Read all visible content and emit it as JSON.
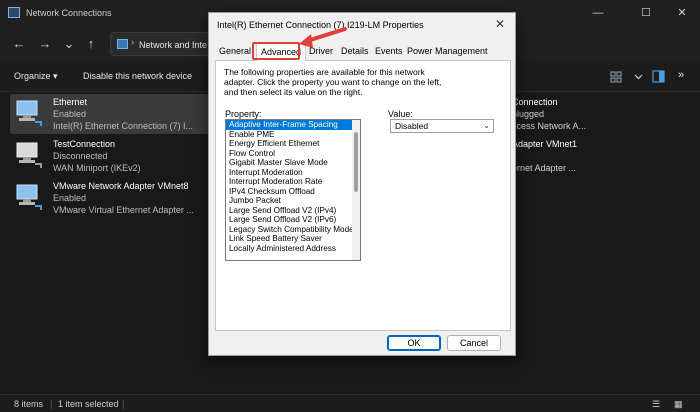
{
  "window": {
    "title": "Network Connections",
    "controls": [
      "—",
      "☐",
      "✕"
    ]
  },
  "nav": {
    "address": "Network and Inte"
  },
  "commands": {
    "organize": "Organize",
    "disable": "Disable this network device"
  },
  "connections": [
    {
      "name": "Ethernet",
      "status": "Enabled",
      "device": "Intel(R) Ethernet Connection (7) I..."
    },
    {
      "name": "TestConnection",
      "status": "Disconnected",
      "device": "WAN Miniport (IKEv2)"
    },
    {
      "name": "VMware Network Adapter VMnet8",
      "status": "Enabled",
      "device": "VMware Virtual Ethernet Adapter ..."
    }
  ],
  "right_column": {
    "line1": "Connection",
    "line2": "plugged",
    "line3": "ccess Network A...",
    "line4": "Adapter VMnet1",
    "line5": "ernet Adapter ..."
  },
  "statusbar": {
    "items": "8 items",
    "selected": "1 item selected"
  },
  "dialog": {
    "title": "Intel(R) Ethernet Connection (7) I219-LM Properties",
    "tabs": [
      "General",
      "Advanced",
      "Driver",
      "Details",
      "Events",
      "Power Management"
    ],
    "active_tab": "Advanced",
    "description": "The following properties are available for this network adapter. Click the property you want to change on the left, and then select its value on the right.",
    "property_label": "Property:",
    "value_label": "Value:",
    "properties": [
      "Adaptive Inter-Frame Spacing",
      "Enable PME",
      "Energy Efficient Ethernet",
      "Flow Control",
      "Gigabit Master Slave Mode",
      "Interrupt Moderation",
      "Interrupt Moderation Rate",
      "IPv4 Checksum Offload",
      "Jumbo Packet",
      "Large Send Offload V2 (IPv4)",
      "Large Send Offload V2 (IPv6)",
      "Legacy Switch Compatibility Mode",
      "Link Speed Battery Saver",
      "Locally Administered Address"
    ],
    "selected_property": "Adaptive Inter-Frame Spacing",
    "value": "Disabled",
    "ok_label": "OK",
    "cancel_label": "Cancel"
  },
  "colors": {
    "highlight": "#e0403a",
    "selection": "#0078d7"
  }
}
